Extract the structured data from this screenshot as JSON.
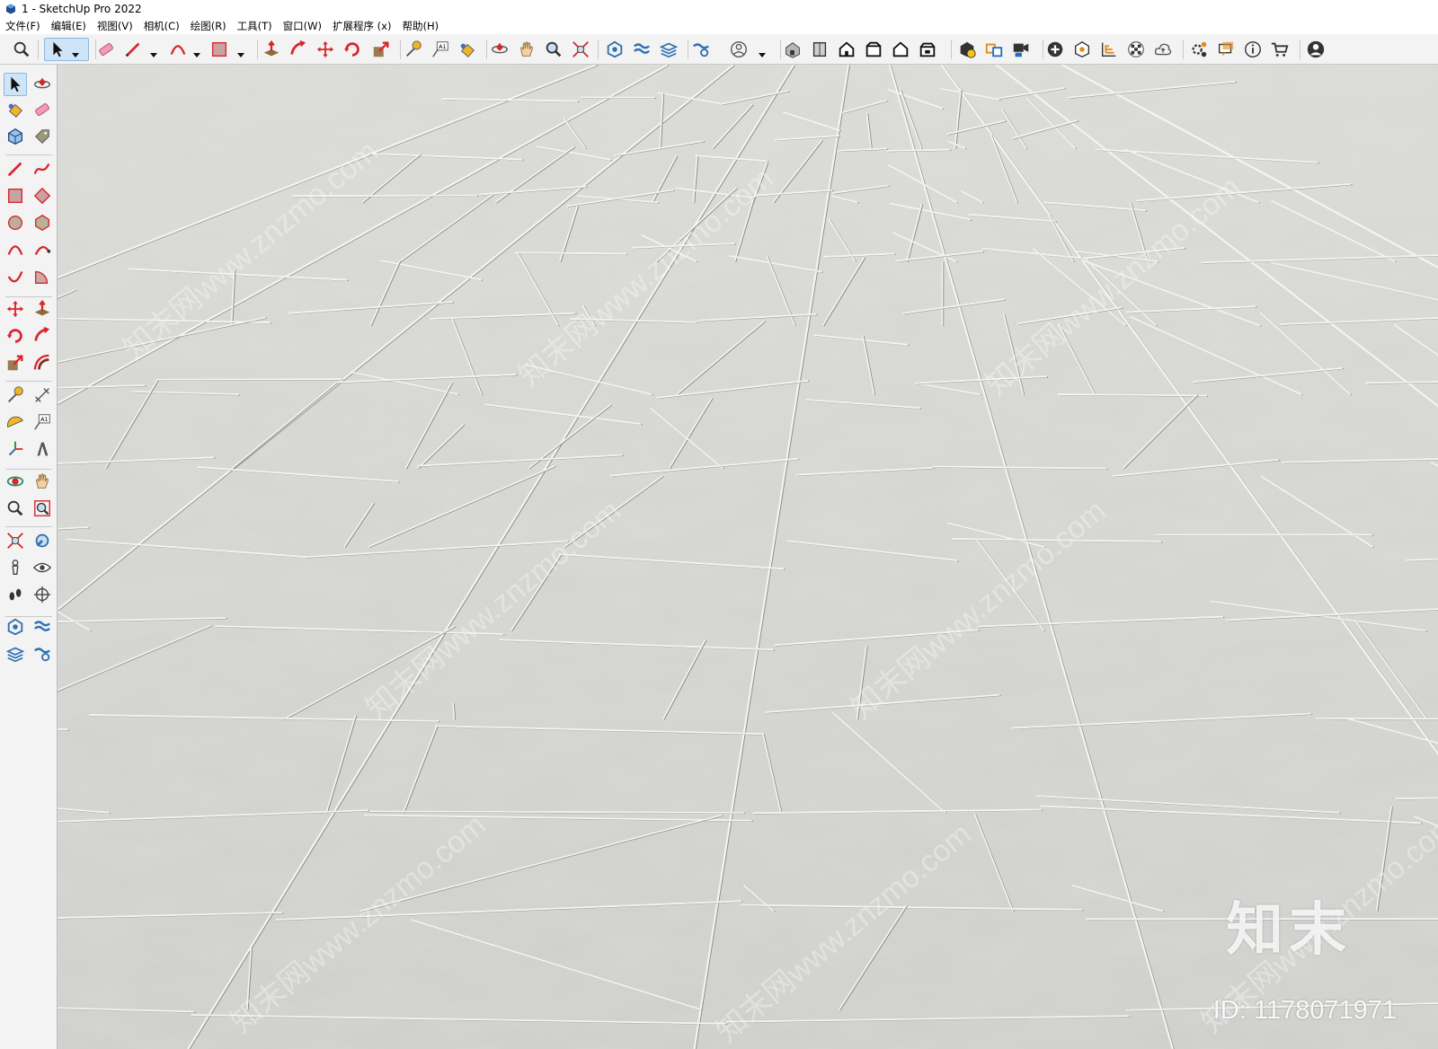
{
  "window": {
    "title": "1 - SketchUp Pro 2022"
  },
  "menu": [
    "文件(F)",
    "编辑(E)",
    "视图(V)",
    "相机(C)",
    "绘图(R)",
    "工具(T)",
    "窗口(W)",
    "扩展程序 (x)",
    "帮助(H)"
  ],
  "toolbar_icons": [
    "zoom-icon",
    "select-icon",
    "eraser-icon",
    "pencil-icon",
    "arc-icon",
    "rectangle-icon",
    "push-pull-icon",
    "follow-me-icon",
    "move-icon",
    "rotate-icon",
    "scale-icon",
    "tape-measure-icon",
    "text-icon",
    "paint-bucket-icon",
    "orbit-icon",
    "pan-icon",
    "zoom-tool-icon",
    "zoom-extents-icon",
    "warehouse-icon",
    "extension-warehouse-icon",
    "layout-icon",
    "extension-manager-icon",
    "account-icon",
    "iso-view-icon",
    "top-view-icon",
    "front-view-icon",
    "right-view-icon",
    "back-view-icon",
    "left-view-icon",
    "solid-inspector-icon",
    "section-icon",
    "scene-icon",
    "add-icon",
    "style-icon",
    "outliner-icon",
    "checker-icon",
    "cloud-icon",
    "settings-icon",
    "message-icon",
    "info-icon",
    "cart-icon",
    "user-icon"
  ],
  "sidebar_icons": [
    "select-icon",
    "orbit-icon",
    "paint-bucket-icon",
    "eraser-icon",
    "component-icon",
    "tag-icon",
    "line-icon",
    "freehand-icon",
    "rectangle-icon",
    "rotated-rectangle-icon",
    "circle-icon",
    "polygon-icon",
    "arc-icon",
    "arc-2pt-icon",
    "arc-3pt-icon",
    "pie-icon",
    "move-icon",
    "push-pull-icon",
    "rotate-icon",
    "follow-me-icon",
    "scale-icon",
    "offset-icon",
    "tape-measure-icon",
    "dimension-icon",
    "protractor-icon",
    "text-icon",
    "axes-icon",
    "3d-text-icon",
    "orbit-tool-icon",
    "pan-icon",
    "zoom-icon",
    "zoom-window-icon",
    "zoom-extents-icon",
    "previous-view-icon",
    "position-camera-icon",
    "look-around-icon",
    "walk-icon",
    "section-plane-icon",
    "warehouse-icon",
    "extension-warehouse-icon",
    "layout-icon",
    "extension-manager-icon"
  ],
  "watermark": {
    "brand": "知末",
    "id_text": "ID: 1178071971",
    "site": "知末网www.znzmo.com"
  },
  "colors": {
    "tile": "#d4d4d2",
    "grout": "#f4f4f2",
    "shadow": "#8a8a88",
    "active_tool": "#cfe4f7"
  }
}
